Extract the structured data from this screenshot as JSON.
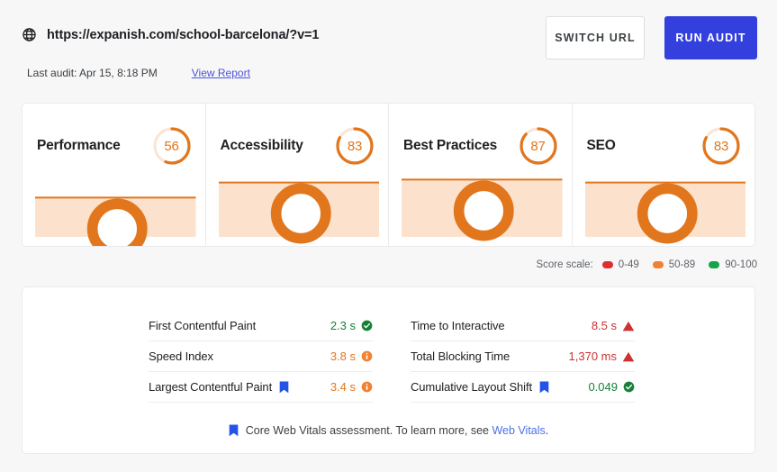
{
  "header": {
    "globe_icon": "globe-icon",
    "url": "https://expanish.com/school-barcelona/?v=1",
    "last_audit": "Last audit: Apr 15, 8:18 PM",
    "view_report": "View Report",
    "switch_url_button": "SWITCH URL",
    "run_audit_button": "RUN AUDIT"
  },
  "colors": {
    "orange": "#e1761d",
    "orange_track": "#fbe5d4",
    "orange_fill": "#fce2cd",
    "red": "#cc3232",
    "green": "#178038",
    "blue": "#3340dd",
    "link_blue": "#4b53d6",
    "bookmark_blue": "#2354e6"
  },
  "scores": [
    {
      "title": "Performance",
      "value": "56",
      "score": 56,
      "spark_top": 0.38
    },
    {
      "title": "Accessibility",
      "value": "83",
      "score": 83,
      "spark_top": 0.17
    },
    {
      "title": "Best Practices",
      "value": "87",
      "score": 87,
      "spark_top": 0.13
    },
    {
      "title": "SEO",
      "value": "83",
      "score": 83,
      "spark_top": 0.17
    }
  ],
  "legend": {
    "label": "Score scale:",
    "items": [
      {
        "range": "0-49",
        "color": "#dc3030"
      },
      {
        "range": "50-89",
        "color": "#ef8233"
      },
      {
        "range": "90-100",
        "color": "#16a34a"
      }
    ]
  },
  "metrics": {
    "left": [
      {
        "name": "First Contentful Paint",
        "value": "2.3 s",
        "status": "pass",
        "tone": "v-green",
        "core_web_vital": false
      },
      {
        "name": "Speed Index",
        "value": "3.8 s",
        "status": "average",
        "tone": "v-orange",
        "core_web_vital": false
      },
      {
        "name": "Largest Contentful Paint",
        "value": "3.4 s",
        "status": "average",
        "tone": "v-orange",
        "core_web_vital": true
      }
    ],
    "right": [
      {
        "name": "Time to Interactive",
        "value": "8.5 s",
        "status": "fail",
        "tone": "v-red",
        "core_web_vital": false
      },
      {
        "name": "Total Blocking Time",
        "value": "1,370 ms",
        "status": "fail",
        "tone": "v-red",
        "core_web_vital": false
      },
      {
        "name": "Cumulative Layout Shift",
        "value": "0.049",
        "status": "pass",
        "tone": "v-green",
        "core_web_vital": true
      }
    ],
    "footnote_prefix": "Core Web Vitals assessment. To learn more, see ",
    "footnote_link": "Web Vitals",
    "footnote_suffix": "."
  },
  "chart_data": {
    "type": "line",
    "title": "Category score sparklines",
    "series": [
      {
        "name": "Performance",
        "values": [
          56,
          56
        ],
        "score": 56
      },
      {
        "name": "Accessibility",
        "values": [
          83,
          83
        ],
        "score": 83
      },
      {
        "name": "Best Practices",
        "values": [
          87,
          87
        ],
        "score": 87
      },
      {
        "name": "SEO",
        "values": [
          83,
          83
        ],
        "score": 83
      }
    ],
    "ylim": [
      0,
      100
    ],
    "grid": false,
    "legend": "none"
  }
}
